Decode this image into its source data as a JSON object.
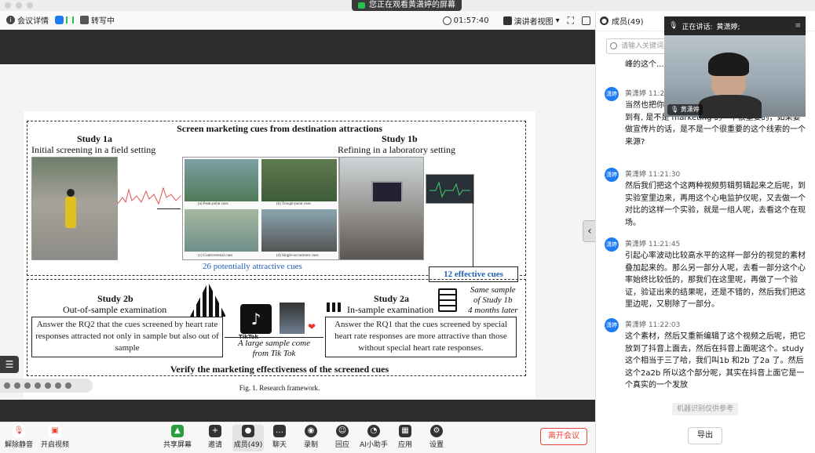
{
  "share_banner": "您正在观看黄潇婷的屏幕",
  "toolbar": {
    "meeting_details": "会议详情",
    "transcribe": "转写中",
    "elapsed": "01:57:40",
    "view_mode": "演讲者视图"
  },
  "figure": {
    "header": "Screen marketing cues from destination attractions",
    "study1a_title": "Study 1a",
    "study1a_sub": "Initial screening in a field setting",
    "study1b_title": "Study 1b",
    "study1b_sub": "Refining in a laboratory setting",
    "photo_caps": [
      "(a) Peak-point cues",
      "(b) Trough-point cues",
      "(c) Controversial cues",
      "(d) Single-occurrence cues"
    ],
    "attractive_cues": "26 potentially attractive cues",
    "effective_cues": "12 effective cues",
    "same_sample_1": "Same sample",
    "same_sample_2": "of Study 1b",
    "same_sample_3": "4 months later",
    "study2b_title": "Study 2b",
    "study2b_sub": "Out-of-sample examination",
    "study2a_title": "Study 2a",
    "study2a_sub": "In-sample examination",
    "tiktok_label": "TikTok",
    "large_sample_1": "A large sample come",
    "large_sample_2": "from Tik Tok",
    "rq2_text": "Answer the RQ2 that the cues screened by heart rate responses attracted not only in sample but also out of sample",
    "rq1_text": "Answer the RQ1 that the cues screened by special heart rate responses are more attractive than those without special heart rate responses.",
    "footer": "Verify the marketing effectiveness of the screened cues",
    "fig_caption": "Fig. 1.  Research framework."
  },
  "controls": {
    "unmute": "解除静音",
    "video": "开启视频",
    "share": "共享屏幕",
    "invite": "邀请",
    "members": "成员(49)",
    "chat": "聊天",
    "record": "录制",
    "replay": "回应",
    "ai": "AI小助手",
    "apps": "应用",
    "settings": "设置",
    "leave": "离开会议"
  },
  "panel": {
    "title": "成员(49)",
    "search_placeholder": "请输入关键词",
    "speaking_label": "正在讲话:",
    "speaker_name": "黄潇婷;",
    "video_name": "黄潇婷",
    "notice": "机器识别仅供参考",
    "export": "导出",
    "messages": [
      {
        "avatar": "潇婷",
        "meta": "",
        "text": "峰的这个... 高峰的这一"
      },
      {
        "avatar": "潇婷",
        "meta": "黄潇婷  11:2",
        "text": "当然也把你... 分呢，就把它想成呀，那我们想要找到有, 是不是 marketing 的一个很重要的，如果要做宣传片的话，是不是一个很重要的这个线索的一个来源?"
      },
      {
        "avatar": "潇婷",
        "meta": "黄潇婷  11:21:30",
        "text": "然后我们把这个这两种视频剪辑剪辑起来之后呢，到实验室里边来，再用这个心电监护仪呢，又去做一个对比的这样一个实验，就是一组人呢，去看这个在现场。"
      },
      {
        "avatar": "潇婷",
        "meta": "黄潇婷  11:21:45",
        "text": "引起心率波动比较高水平的这样一部分的视觉的素材叠加起来的。那么另一部分人呢，去看一部分这个心率始终比较低的，那我们在这里呢，再做了一个验证，验证出来的结果呢，还是不错的，然后我们把这里边呢，又剔除了一部分。"
      },
      {
        "avatar": "潇婷",
        "meta": "黄潇婷  11:22:03",
        "text": "这个素材，然后又重新编辑了这个视频之后呢，把它放到了抖音上面去，然后在抖音上面呢这个。study 这个相当于三了哈，我们叫1b 和2b 了2a 了。然后这个2a2b 所以这个部分呢，其实在抖音上面它是一个真实的一个发放"
      }
    ]
  },
  "colors": {
    "accent": "#1d7cf2",
    "leave": "#e5483a",
    "cue_blue": "#1e5fb4"
  }
}
